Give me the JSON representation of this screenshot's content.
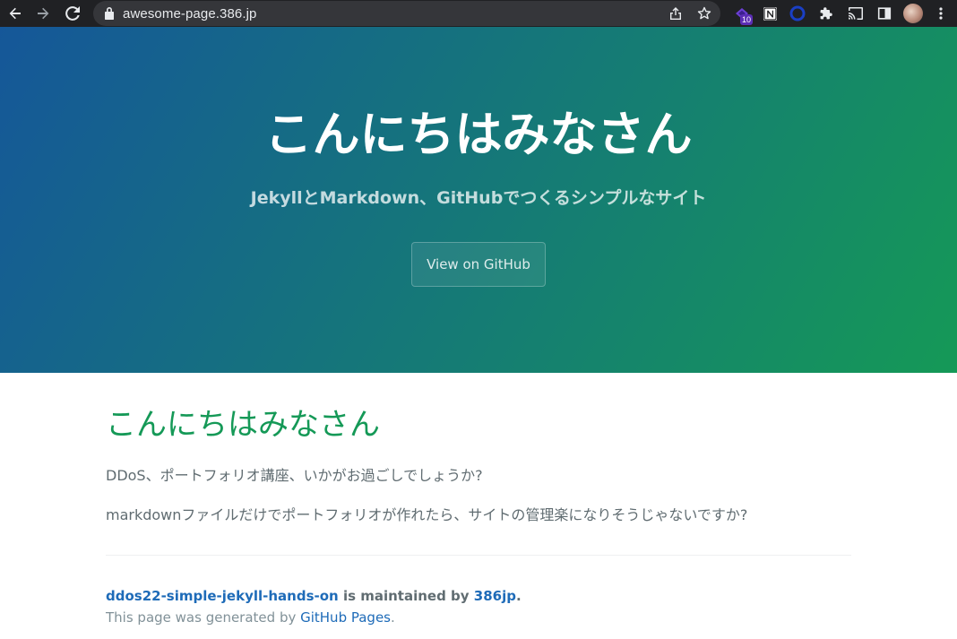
{
  "browser": {
    "url": "awesome-page.386.jp",
    "extension_badge": "10",
    "icons": [
      "back-arrow-icon",
      "forward-arrow-icon",
      "reload-icon",
      "lock-icon",
      "share-icon",
      "bookmark-star-icon",
      "extension-icon",
      "notion-icon",
      "circle-extension-icon",
      "puzzle-icon",
      "cast-icon",
      "sidebar-icon",
      "avatar",
      "menu-kebab-icon"
    ]
  },
  "hero": {
    "title": "こんにちはみなさん",
    "tagline": "JekyllとMarkdown、GitHubでつくるシンプルなサイト",
    "button_label": "View on GitHub",
    "gradient_colors": [
      "#155799",
      "#159957"
    ]
  },
  "main": {
    "heading": "こんにちはみなさん",
    "paragraph1": "DDoS、ポートフォリオ講座、いかがお過ごしでしょうか?",
    "paragraph2": "markdownファイルだけでポートフォリオが作れたら、サイトの管理楽になりそうじゃないですか?"
  },
  "footer": {
    "repo_link": "ddos22-simple-jekyll-hands-on",
    "maintained_by_text": " is maintained by ",
    "owner_link": "386jp",
    "period": ".",
    "generated_prefix": "This page was generated by ",
    "generator_link": "GitHub Pages",
    "generated_suffix": "."
  },
  "colors": {
    "toolbar_bg": "#202124",
    "heading_green": "#159957",
    "link_blue": "#1e6bb8",
    "body_text": "#606c71"
  }
}
